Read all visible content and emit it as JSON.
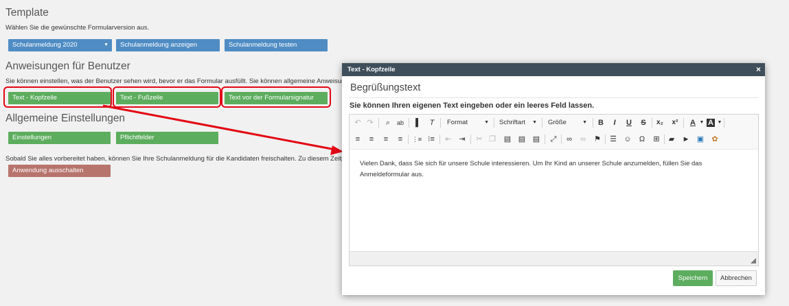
{
  "template": {
    "heading": "Template",
    "description": "Wählen Sie die gewünschte Formularversion aus.",
    "select_value": "Schulanmeldung 2020",
    "show_button": "Schulanmeldung anzeigen",
    "test_button": "Schulanmeldung testen"
  },
  "instructions": {
    "heading": "Anweisungen für Benutzer",
    "description": "Sie können einstellen, was der Benutzer sehen wird, bevor er das Formular ausfüllt. Sie können allgemeine Anweisungen s",
    "header_button": "Text - Kopfzeile",
    "footer_button": "Text - Fußzeile",
    "signature_button": "Text vor der Formularsignatur"
  },
  "general": {
    "heading": "Allgemeine Einstellungen",
    "settings_button": "Einstellungen",
    "required_button": "Pflichtfelder",
    "release_text": "Sobald Sie alles vorbereitet haben, können Sie Ihre Schulanmeldung für die Kandidaten freischalten. Zu diesem Zeitpunkt i",
    "disable_button": "Anwendung ausschalten"
  },
  "dialog": {
    "header": "Text - Kopfzeile",
    "close": "×",
    "title": "Begrüßungstext",
    "hint": "Sie können Ihren eigenen Text eingeben oder ein leeres Feld lassen.",
    "toolbar": {
      "format": "Format",
      "font": "Schriftart",
      "size": "Größe"
    },
    "content": "Vielen Dank, dass Sie sich für unsere Schule interessieren. Um Ihr Kind an unserer Schule anzumelden, füllen Sie das Anmeldeformular aus.",
    "save_button": "Speichern",
    "cancel_button": "Abbrechen"
  },
  "colors": {
    "blue_button": "#4f8cc4",
    "green_button": "#5cad5e",
    "red_button": "#b7746c",
    "highlight": "#e30613",
    "dialog_header": "#3e4e5a"
  }
}
